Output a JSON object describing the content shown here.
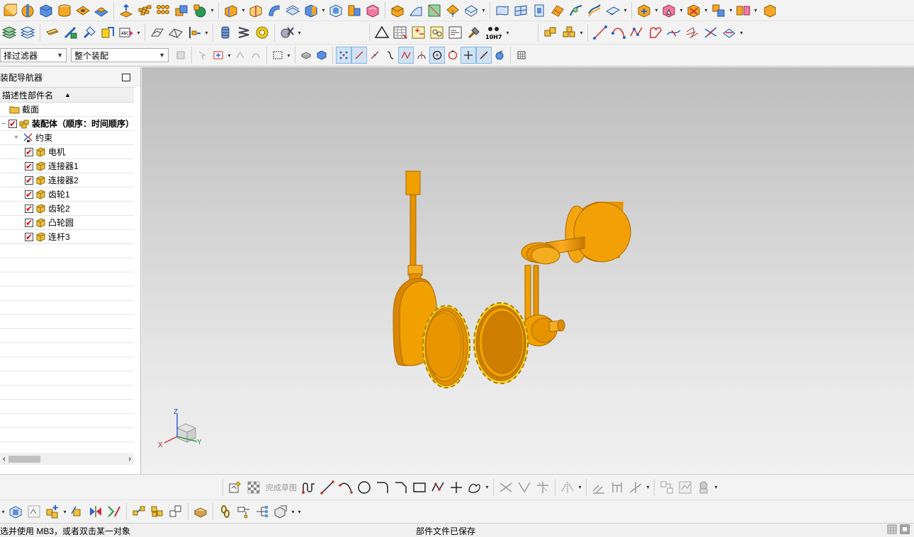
{
  "filters": {
    "selection_filter": "择过滤器",
    "assembly_scope": "整个装配"
  },
  "navigator": {
    "title": "装配导航器",
    "column_header": "描述性部件名",
    "section_node": "截面",
    "root_node": "装配体（顺序：时间顺序）",
    "constraints_node": "约束",
    "parts": [
      "电机",
      "连接器1",
      "连接器2",
      "齿轮1",
      "齿轮2",
      "凸轮圆",
      "连杆3"
    ]
  },
  "sketch_toolbar": {
    "finish_sketch": "完成草图"
  },
  "tolerance_label": "10H7",
  "status": {
    "prompt": "选并使用 MB3，或者双击某一对象",
    "message": "部件文件已保存"
  },
  "triad": {
    "x": "X",
    "y": "Y",
    "z": "Z"
  },
  "colors": {
    "part_orange": "#f0a000",
    "part_dark": "#c97800",
    "gear_yellow": "#ffd21a"
  }
}
